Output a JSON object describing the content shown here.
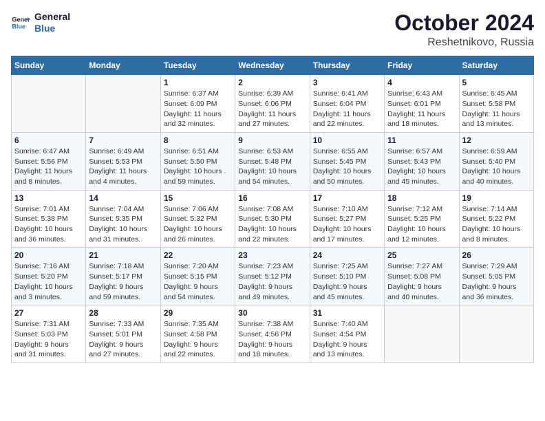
{
  "logo": {
    "line1": "General",
    "line2": "Blue"
  },
  "title": "October 2024",
  "subtitle": "Reshetnikovo, Russia",
  "days_header": [
    "Sunday",
    "Monday",
    "Tuesday",
    "Wednesday",
    "Thursday",
    "Friday",
    "Saturday"
  ],
  "weeks": [
    [
      {
        "day": "",
        "info": ""
      },
      {
        "day": "",
        "info": ""
      },
      {
        "day": "1",
        "info": "Sunrise: 6:37 AM\nSunset: 6:09 PM\nDaylight: 11 hours\nand 32 minutes."
      },
      {
        "day": "2",
        "info": "Sunrise: 6:39 AM\nSunset: 6:06 PM\nDaylight: 11 hours\nand 27 minutes."
      },
      {
        "day": "3",
        "info": "Sunrise: 6:41 AM\nSunset: 6:04 PM\nDaylight: 11 hours\nand 22 minutes."
      },
      {
        "day": "4",
        "info": "Sunrise: 6:43 AM\nSunset: 6:01 PM\nDaylight: 11 hours\nand 18 minutes."
      },
      {
        "day": "5",
        "info": "Sunrise: 6:45 AM\nSunset: 5:58 PM\nDaylight: 11 hours\nand 13 minutes."
      }
    ],
    [
      {
        "day": "6",
        "info": "Sunrise: 6:47 AM\nSunset: 5:56 PM\nDaylight: 11 hours\nand 8 minutes."
      },
      {
        "day": "7",
        "info": "Sunrise: 6:49 AM\nSunset: 5:53 PM\nDaylight: 11 hours\nand 4 minutes."
      },
      {
        "day": "8",
        "info": "Sunrise: 6:51 AM\nSunset: 5:50 PM\nDaylight: 10 hours\nand 59 minutes."
      },
      {
        "day": "9",
        "info": "Sunrise: 6:53 AM\nSunset: 5:48 PM\nDaylight: 10 hours\nand 54 minutes."
      },
      {
        "day": "10",
        "info": "Sunrise: 6:55 AM\nSunset: 5:45 PM\nDaylight: 10 hours\nand 50 minutes."
      },
      {
        "day": "11",
        "info": "Sunrise: 6:57 AM\nSunset: 5:43 PM\nDaylight: 10 hours\nand 45 minutes."
      },
      {
        "day": "12",
        "info": "Sunrise: 6:59 AM\nSunset: 5:40 PM\nDaylight: 10 hours\nand 40 minutes."
      }
    ],
    [
      {
        "day": "13",
        "info": "Sunrise: 7:01 AM\nSunset: 5:38 PM\nDaylight: 10 hours\nand 36 minutes."
      },
      {
        "day": "14",
        "info": "Sunrise: 7:04 AM\nSunset: 5:35 PM\nDaylight: 10 hours\nand 31 minutes."
      },
      {
        "day": "15",
        "info": "Sunrise: 7:06 AM\nSunset: 5:32 PM\nDaylight: 10 hours\nand 26 minutes."
      },
      {
        "day": "16",
        "info": "Sunrise: 7:08 AM\nSunset: 5:30 PM\nDaylight: 10 hours\nand 22 minutes."
      },
      {
        "day": "17",
        "info": "Sunrise: 7:10 AM\nSunset: 5:27 PM\nDaylight: 10 hours\nand 17 minutes."
      },
      {
        "day": "18",
        "info": "Sunrise: 7:12 AM\nSunset: 5:25 PM\nDaylight: 10 hours\nand 12 minutes."
      },
      {
        "day": "19",
        "info": "Sunrise: 7:14 AM\nSunset: 5:22 PM\nDaylight: 10 hours\nand 8 minutes."
      }
    ],
    [
      {
        "day": "20",
        "info": "Sunrise: 7:16 AM\nSunset: 5:20 PM\nDaylight: 10 hours\nand 3 minutes."
      },
      {
        "day": "21",
        "info": "Sunrise: 7:18 AM\nSunset: 5:17 PM\nDaylight: 9 hours\nand 59 minutes."
      },
      {
        "day": "22",
        "info": "Sunrise: 7:20 AM\nSunset: 5:15 PM\nDaylight: 9 hours\nand 54 minutes."
      },
      {
        "day": "23",
        "info": "Sunrise: 7:23 AM\nSunset: 5:12 PM\nDaylight: 9 hours\nand 49 minutes."
      },
      {
        "day": "24",
        "info": "Sunrise: 7:25 AM\nSunset: 5:10 PM\nDaylight: 9 hours\nand 45 minutes."
      },
      {
        "day": "25",
        "info": "Sunrise: 7:27 AM\nSunset: 5:08 PM\nDaylight: 9 hours\nand 40 minutes."
      },
      {
        "day": "26",
        "info": "Sunrise: 7:29 AM\nSunset: 5:05 PM\nDaylight: 9 hours\nand 36 minutes."
      }
    ],
    [
      {
        "day": "27",
        "info": "Sunrise: 7:31 AM\nSunset: 5:03 PM\nDaylight: 9 hours\nand 31 minutes."
      },
      {
        "day": "28",
        "info": "Sunrise: 7:33 AM\nSunset: 5:01 PM\nDaylight: 9 hours\nand 27 minutes."
      },
      {
        "day": "29",
        "info": "Sunrise: 7:35 AM\nSunset: 4:58 PM\nDaylight: 9 hours\nand 22 minutes."
      },
      {
        "day": "30",
        "info": "Sunrise: 7:38 AM\nSunset: 4:56 PM\nDaylight: 9 hours\nand 18 minutes."
      },
      {
        "day": "31",
        "info": "Sunrise: 7:40 AM\nSunset: 4:54 PM\nDaylight: 9 hours\nand 13 minutes."
      },
      {
        "day": "",
        "info": ""
      },
      {
        "day": "",
        "info": ""
      }
    ]
  ]
}
